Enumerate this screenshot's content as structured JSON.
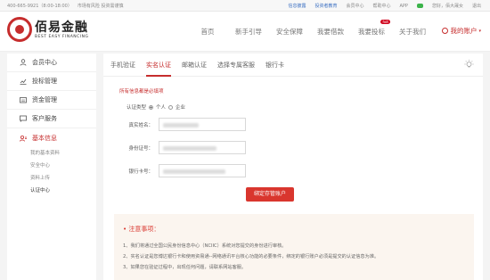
{
  "topbar": {
    "phone": "400-665-9921（8:00-18:00）",
    "risk": "市场有风险 投资需谨慎",
    "links": [
      "信息披露",
      "投资者教育",
      "会员中心",
      "帮助中心",
      "APP"
    ],
    "hello": "您好，",
    "user": "佰大晟女",
    "logout": "退出"
  },
  "logo": {
    "cn": "佰易金融",
    "en": "BEST EASY FINANCING"
  },
  "nav": {
    "items": [
      "首页",
      "新手引导",
      "安全保障",
      "我要借款",
      "我要投标",
      "关于我们"
    ],
    "badge": "hot",
    "account": "我的账户"
  },
  "sidebar": {
    "items": [
      "会员中心",
      "投标管理",
      "资金管理",
      "客户服务",
      "基本信息"
    ],
    "subs": [
      "我的基本资料",
      "安全中心",
      "资料上传",
      "认证中心"
    ]
  },
  "tabs": [
    "手机验证",
    "实名认证",
    "邮箱认证",
    "选择专属客服",
    "银行卡"
  ],
  "form": {
    "required_note": "所有信息都是必填项",
    "type_label": "认证类型",
    "type_personal": "个人",
    "type_company": "企业",
    "name_label": "真实姓名：",
    "id_label": "身份证号：",
    "bank_label": "银行卡号：",
    "submit": "绑定存管账户"
  },
  "notice": {
    "title": "注意事项：",
    "lines": [
      "1、我们将通过全国公民身份信息中心（NCIIC）系统对您提交的身份进行审核。",
      "2、实名认证是您博达银行卡和使用资易通--网络通讯平台核心功能的必要条件，绑定的银行账户必须是提交的认证信息为准。",
      "3、如果您在验证过程中，出现任何问题，请联系网站客服。"
    ]
  },
  "colors": {
    "accent": "#c62d2d",
    "button": "#d9362e",
    "notice_bg": "#fbf5ef"
  }
}
